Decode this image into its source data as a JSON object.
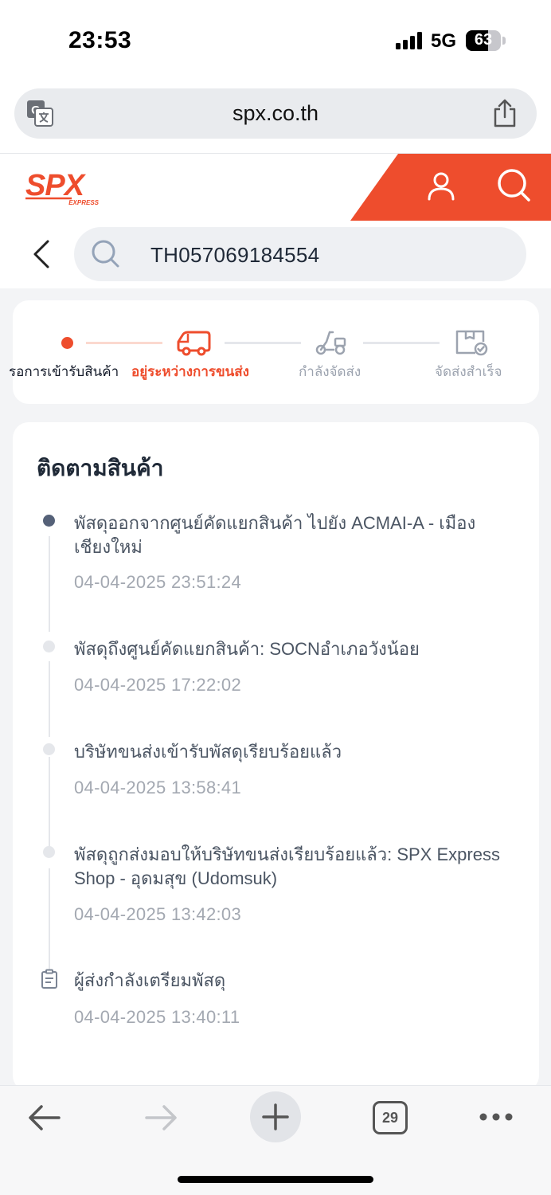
{
  "status_bar": {
    "time": "23:53",
    "network": "5G",
    "battery": "63",
    "battery_level": 0.63
  },
  "browser": {
    "url": "spx.co.th"
  },
  "header": {
    "brand": "SPX",
    "brand_sub": "EXPRESS",
    "accent_color": "#ee4d2d"
  },
  "search": {
    "value": "TH057069184554"
  },
  "progress": {
    "steps": [
      {
        "label": "รอการเข้ารับสินค้า",
        "state": "done"
      },
      {
        "label": "อยู่ระหว่างการขนส่ง",
        "state": "current"
      },
      {
        "label": "กำลังจัดส่ง",
        "state": "pending"
      },
      {
        "label": "จัดส่งสำเร็จ",
        "state": "pending"
      }
    ]
  },
  "tracking": {
    "title": "ติดตามสินค้า",
    "events": [
      {
        "text": "พัสดุออกจากศูนย์คัดแยกสินค้า ไปยัง ACMAI-A - เมืองเชียงใหม่",
        "time": "04-04-2025 23:51:24"
      },
      {
        "text": "พัสดุถึงศูนย์คัดแยกสินค้า: SOCNอำเภอวังน้อย",
        "time": "04-04-2025 17:22:02"
      },
      {
        "text": "บริษัทขนส่งเข้ารับพัสดุเรียบร้อยแล้ว",
        "time": "04-04-2025 13:58:41"
      },
      {
        "text": "พัสดุถูกส่งมอบให้บริษัทขนส่งเรียบร้อยแล้ว: SPX Express Shop - อุดมสุข (Udomsuk)",
        "time": "04-04-2025 13:42:03"
      },
      {
        "text": "ผู้ส่งกำลังเตรียมพัสดุ",
        "time": "04-04-2025 13:40:11"
      }
    ]
  },
  "toolbar": {
    "tab_count": "29"
  }
}
